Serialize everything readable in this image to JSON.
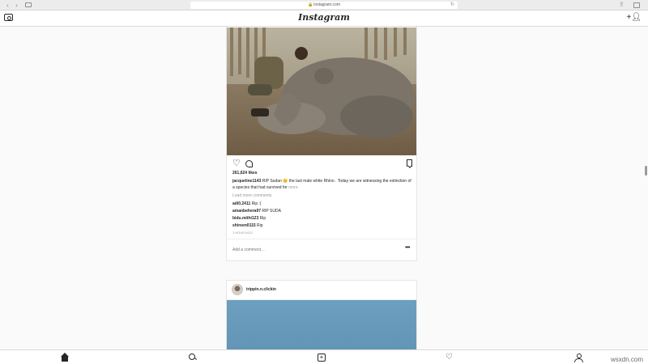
{
  "browser": {
    "url": "instagram.com",
    "back_icon": "chevron-left-icon",
    "forward_icon": "chevron-right-icon",
    "sidebar_icon": "sidebar-icon",
    "reload_icon": "reload-icon",
    "share_icon": "share-icon",
    "tabs_icon": "tabs-icon"
  },
  "header": {
    "logo": "Instagram",
    "camera_icon": "camera-icon",
    "add_user_icon": "add-user-icon"
  },
  "post1": {
    "likes": "261,624 likes",
    "caption_user": "jacqueline1143",
    "caption_text": "RIP Sudan 😔 the last male white Rhino . Today we are witnessing the extinction of a species that had survived for",
    "caption_more": "more",
    "load_more": "Load more comments",
    "comments": [
      {
        "user": "adi0.2411",
        "text": "Rip :("
      },
      {
        "user": "amanbehera97",
        "text": "RIP SUDA"
      },
      {
        "user": "bidu.mithi123",
        "text": "Rip"
      },
      {
        "user": "shireen0115",
        "text": "Rip"
      }
    ],
    "time": "1 hour ago",
    "add_comment_placeholder": "Add a comment…",
    "more_options": "•••"
  },
  "post2": {
    "username": "trippin.n.clickin"
  },
  "tab_bar": {
    "items": [
      "home-icon",
      "search-icon",
      "new-post-icon",
      "activity-icon",
      "profile-icon"
    ]
  },
  "watermark": "wsxdn.com",
  "colors": {
    "background": "#fafafa",
    "border": "#dbdbdb",
    "text": "#262626",
    "muted": "#999999"
  }
}
